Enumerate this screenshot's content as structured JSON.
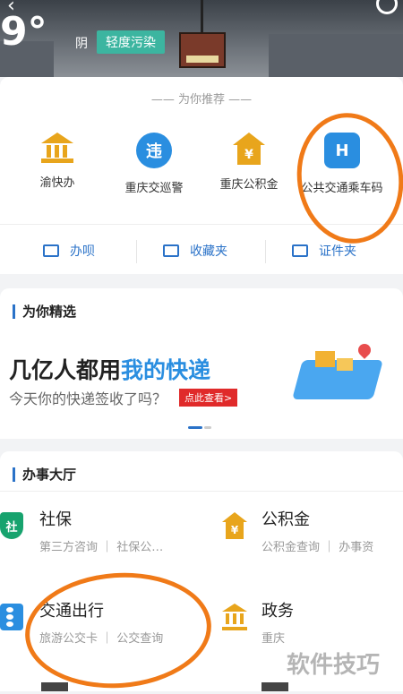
{
  "header": {
    "temperature": "9°",
    "weather": "阴",
    "air_quality": "轻度污染"
  },
  "recommend": {
    "title": "—— 为你推荐 ——",
    "services": [
      {
        "label": "渝快办"
      },
      {
        "label": "重庆交巡警",
        "icon_text": "违"
      },
      {
        "label": "重庆公积金",
        "icon_text": "¥"
      },
      {
        "label": "公共交通乘车码",
        "icon_text": "H"
      }
    ],
    "quick_actions": [
      {
        "label": "办呗"
      },
      {
        "label": "收藏夹"
      },
      {
        "label": "证件夹"
      }
    ]
  },
  "featured": {
    "title": "为你精选",
    "banner_part1": "几亿人都用",
    "banner_highlight": "我的快递",
    "banner_sub": "今天你的快递签收了吗？",
    "banner_cta": "点此查看>"
  },
  "hall": {
    "title": "办事大厅",
    "tiles": [
      {
        "title": "社保",
        "subtitle": "第三方咨询 ｜ 社保公…",
        "icon_text": "社"
      },
      {
        "title": "公积金",
        "subtitle": "公积金查询 ｜ 办事资",
        "icon_text": "¥"
      },
      {
        "title": "交通出行",
        "subtitle": "旅游公交卡 ｜ 公交查询"
      },
      {
        "title": "政务",
        "subtitle": "重庆"
      }
    ]
  },
  "watermark": "软件技巧",
  "colors": {
    "accent_blue": "#2a72c8",
    "air_quality_green": "#3cb5a0",
    "annotation_orange": "#f07a18",
    "gold": "#e8a51c"
  }
}
